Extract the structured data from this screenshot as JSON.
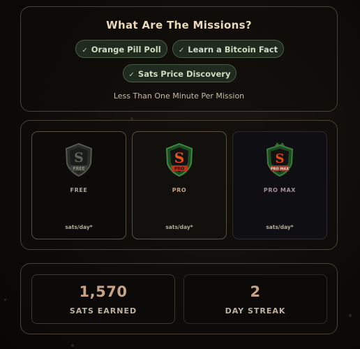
{
  "missions": {
    "title": "What Are The Missions?",
    "items": [
      {
        "icon": "check-icon",
        "label": "Orange Pill Poll"
      },
      {
        "icon": "check-icon",
        "label": "Learn a Bitcoin Fact"
      },
      {
        "icon": "check-icon",
        "label": "Sats Price Discovery"
      }
    ],
    "subtitle": "Less Than One Minute Per Mission"
  },
  "tiers": [
    {
      "name": "FREE",
      "badge_text": "FREE",
      "rate_label": "sats/day*"
    },
    {
      "name": "PRO",
      "badge_text": "PRO",
      "rate_label": "sats/day*"
    },
    {
      "name": "PRO MAX",
      "badge_text": "PRO MAX",
      "rate_label": "sats/day*"
    }
  ],
  "stats": {
    "earned": {
      "value": "1,570",
      "label": "SATS EARNED"
    },
    "streak": {
      "value": "2",
      "label": "DAY STREAK"
    }
  },
  "colors": {
    "background": "#0d0b09",
    "pill_bg": "#202b20",
    "pro_red": "#e04a1a",
    "shield_green": "#2f7a34",
    "stat_value": "#c9a386"
  }
}
